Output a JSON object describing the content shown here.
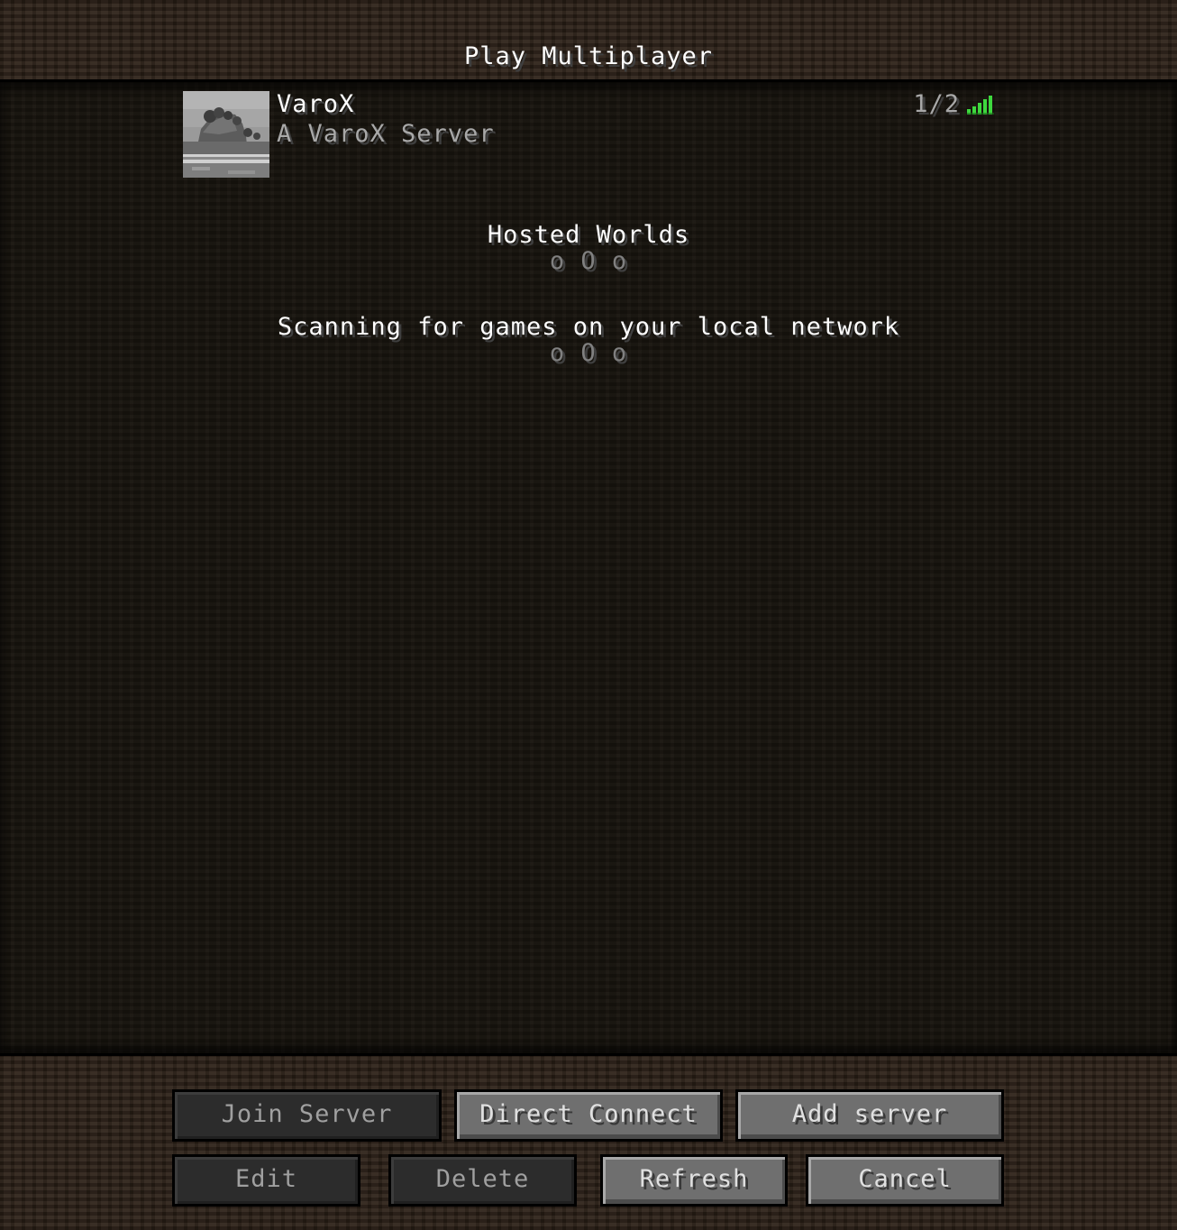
{
  "screen": {
    "title": "Play Multiplayer"
  },
  "servers": [
    {
      "name": "VaroX",
      "motd": "A VaroX Server",
      "players": "1/2",
      "icon": "landscape-thumbnail-icon",
      "signal": "signal-bars-full-icon",
      "signal_color": "#3ed83e"
    }
  ],
  "hosted_worlds": {
    "title": "Hosted Worlds",
    "dots": "o O o"
  },
  "lan": {
    "title": "Scanning for games on your local network",
    "dots": "o O o"
  },
  "buttons": {
    "join": "Join Server",
    "direct": "Direct Connect",
    "add": "Add server",
    "edit": "Edit",
    "delete": "Delete",
    "refresh": "Refresh",
    "cancel": "Cancel"
  },
  "button_state": {
    "join": "disabled",
    "edit": "disabled",
    "delete": "disabled",
    "direct": "enabled",
    "add": "enabled",
    "refresh": "enabled",
    "cancel": "enabled"
  }
}
